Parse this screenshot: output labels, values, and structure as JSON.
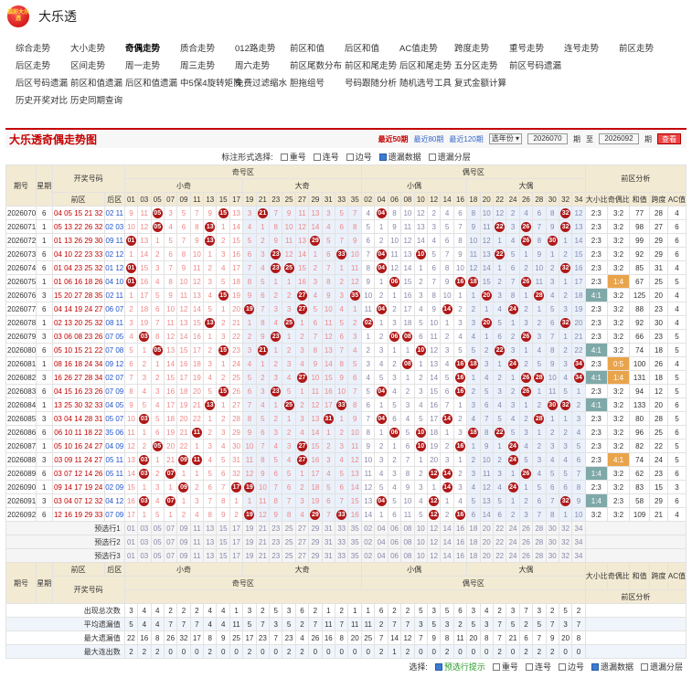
{
  "site": {
    "name": "大乐透",
    "logo_text": "福彩大乐透"
  },
  "nav": [
    [
      "综合走势",
      "大小走势",
      "奇偶走势",
      "质合走势",
      "012路走势",
      "前区和值",
      "后区和值",
      "AC值走势",
      "跨度走势",
      "重号走势",
      "连号走势",
      "前区走势"
    ],
    [
      "后区走势",
      "区间走势",
      "周一走势",
      "周三走势",
      "周六走势",
      "前区尾数分布",
      "前区和尾走势",
      "后区和尾走势",
      "五分区走势",
      "前区号码遗漏"
    ],
    [
      "后区号码遗漏",
      "前区和值遗漏",
      "后区和值遗漏",
      "中5保4旋转矩阵",
      "免费过滤缩水",
      "胆拖组号",
      "号码跟随分析",
      "随机选号工具",
      "复式金额计算"
    ],
    [
      "历史开奖对比",
      "历史同期查询"
    ]
  ],
  "nav_active": "奇偶走势",
  "chart": {
    "title": "大乐透奇偶走势图",
    "period_50": "最近50期",
    "period_80": "最近80期",
    "period_120": "最近120期",
    "select_year": "选年份",
    "from_issue": "2026070",
    "label_qi": "期",
    "label_to": "至",
    "to_issue": "2026092",
    "query": "查看"
  },
  "options": {
    "label": "标注形式选择:",
    "items": [
      {
        "label": "重号",
        "on": false
      },
      {
        "label": "连号",
        "on": false
      },
      {
        "label": "边号",
        "on": false
      },
      {
        "label": "遗漏数据",
        "on": true
      },
      {
        "label": "遗漏分层",
        "on": false
      }
    ]
  },
  "headers": {
    "issue": "期号",
    "week": "星期",
    "draw": "开奖号码",
    "front": "前区",
    "back": "后区",
    "odd_zone": "奇号区",
    "even_zone": "偶号区",
    "small_odd": "小奇",
    "big_odd": "大奇",
    "small_even": "小偶",
    "big_even": "大偶",
    "analysis": "前区分析",
    "cols_analysis": [
      "大小比",
      "奇偶比",
      "和值",
      "跨度",
      "AC值"
    ],
    "odd_nums": [
      "01",
      "03",
      "05",
      "07",
      "09",
      "11",
      "13",
      "15",
      "17",
      "19",
      "21",
      "23",
      "25",
      "27",
      "29",
      "31",
      "33",
      "35"
    ],
    "even_nums": [
      "02",
      "04",
      "06",
      "08",
      "10",
      "12",
      "14",
      "16",
      "18",
      "20",
      "22",
      "24",
      "26",
      "28",
      "30",
      "32",
      "34"
    ]
  },
  "rows": [
    {
      "issue": "2026070",
      "week": "6",
      "front": "04 05 15 21 32",
      "back": "02 11",
      "balls": [
        "05",
        "15",
        "21",
        "32",
        "04"
      ],
      "an": [
        "2:3",
        "3:2",
        "77",
        "28",
        "4"
      ]
    },
    {
      "issue": "2026071",
      "week": "1",
      "front": "05 13 22 26 32",
      "back": "02 03",
      "balls": [
        "05",
        "13",
        "22",
        "26",
        "32"
      ],
      "an": [
        "2:3",
        "3:2",
        "98",
        "27",
        "6"
      ]
    },
    {
      "issue": "2026072",
      "week": "1",
      "front": "01 13 26 29 30",
      "back": "09 11",
      "balls": [
        "01",
        "13",
        "26",
        "29",
        "30"
      ],
      "an": [
        "2:3",
        "3:2",
        "99",
        "29",
        "6"
      ]
    },
    {
      "issue": "2026073",
      "week": "6",
      "front": "04 10 22 23 33",
      "back": "02 12",
      "balls": [
        "04",
        "10",
        "22",
        "23",
        "33"
      ],
      "an": [
        "2:3",
        "3:2",
        "92",
        "29",
        "6"
      ]
    },
    {
      "issue": "2026074",
      "week": "6",
      "front": "01 04 23 25 32",
      "back": "01 12",
      "balls": [
        "01",
        "04",
        "23",
        "25",
        "32"
      ],
      "an": [
        "2:3",
        "3:2",
        "85",
        "31",
        "4"
      ]
    },
    {
      "issue": "2026075",
      "week": "1",
      "front": "01 06 16 18 26",
      "back": "04 10",
      "balls": [
        "01",
        "06",
        "16",
        "18",
        "26"
      ],
      "an": [
        "2:3",
        "1:4",
        "67",
        "25",
        "5"
      ]
    },
    {
      "issue": "2026076",
      "week": "3",
      "front": "15 20 27 28 35",
      "back": "02 11",
      "balls": [
        "15",
        "20",
        "27",
        "28",
        "35"
      ],
      "an": [
        "4:1",
        "3:2",
        "125",
        "20",
        "4"
      ]
    },
    {
      "issue": "2026077",
      "week": "6",
      "front": "04 14 19 24 27",
      "back": "06 07",
      "balls": [
        "04",
        "14",
        "19",
        "24",
        "27"
      ],
      "an": [
        "2:3",
        "3:2",
        "88",
        "23",
        "4"
      ]
    },
    {
      "issue": "2026078",
      "week": "1",
      "front": "02 13 20 25 32",
      "back": "08 11",
      "balls": [
        "02",
        "13",
        "20",
        "25",
        "32"
      ],
      "an": [
        "2:3",
        "3:2",
        "92",
        "30",
        "4"
      ]
    },
    {
      "issue": "2026079",
      "week": "3",
      "front": "03 06 08 23 26",
      "back": "07 05",
      "balls": [
        "03",
        "06",
        "08",
        "23",
        "26"
      ],
      "an": [
        "2:3",
        "3:2",
        "66",
        "23",
        "5"
      ]
    },
    {
      "issue": "2026080",
      "week": "6",
      "front": "05 10 15 21 22",
      "back": "07 08",
      "balls": [
        "05",
        "10",
        "15",
        "21",
        "22"
      ],
      "an": [
        "4:1",
        "3:2",
        "74",
        "18",
        "5"
      ]
    },
    {
      "issue": "2026081",
      "week": "1",
      "front": "08 16 18 24 34",
      "back": "09 12",
      "balls": [
        "08",
        "16",
        "18",
        "24",
        "34"
      ],
      "an": [
        "2:3",
        "0:5",
        "100",
        "26",
        "4"
      ]
    },
    {
      "issue": "2026082",
      "week": "3",
      "front": "16 26 27 28 34",
      "back": "02 07",
      "balls": [
        "16",
        "26",
        "27",
        "28",
        "34"
      ],
      "an": [
        "4:1",
        "1:4",
        "131",
        "18",
        "5"
      ]
    },
    {
      "issue": "2026083",
      "week": "6",
      "front": "04 15 16 23 26",
      "back": "07 09",
      "balls": [
        "04",
        "15",
        "16",
        "23",
        "26"
      ],
      "an": [
        "2:3",
        "3:2",
        "94",
        "12",
        "5"
      ]
    },
    {
      "issue": "2026084",
      "week": "1",
      "front": "13 25 30 32 33",
      "back": "04 05",
      "balls": [
        "13",
        "25",
        "30",
        "32",
        "33"
      ],
      "an": [
        "4:1",
        "3:2",
        "133",
        "20",
        "6"
      ]
    },
    {
      "issue": "2026085",
      "week": "3",
      "front": "03 04 14 28 31",
      "back": "05 07",
      "balls": [
        "03",
        "04",
        "14",
        "28",
        "31"
      ],
      "an": [
        "2:3",
        "3:2",
        "80",
        "28",
        "5"
      ]
    },
    {
      "issue": "2026086",
      "week": "6",
      "front": "06 10 11 18 22",
      "back": "35 06",
      "balls": [
        "06",
        "10",
        "11",
        "18",
        "22"
      ],
      "an": [
        "2:3",
        "3:2",
        "96",
        "25",
        "6"
      ]
    },
    {
      "issue": "2026087",
      "week": "1",
      "front": "05 10 16 24 27",
      "back": "04 09",
      "balls": [
        "05",
        "10",
        "16",
        "24",
        "27"
      ],
      "an": [
        "2:3",
        "3:2",
        "82",
        "22",
        "5"
      ]
    },
    {
      "issue": "2026088",
      "week": "3",
      "front": "03 09 11 24 27",
      "back": "05 11",
      "balls": [
        "03",
        "09",
        "11",
        "24",
        "27"
      ],
      "an": [
        "2:3",
        "4:1",
        "74",
        "24",
        "5"
      ]
    },
    {
      "issue": "2026089",
      "week": "6",
      "front": "03 07 12 14 26",
      "back": "05 11",
      "balls": [
        "03",
        "07",
        "12",
        "14",
        "26"
      ],
      "an": [
        "1:4",
        "3:2",
        "62",
        "23",
        "6"
      ]
    },
    {
      "issue": "2026090",
      "week": "1",
      "front": "09 14 17 19 24",
      "back": "02 09",
      "balls": [
        "09",
        "14",
        "17",
        "19",
        "24"
      ],
      "an": [
        "2:3",
        "3:2",
        "83",
        "15",
        "3"
      ]
    },
    {
      "issue": "2026091",
      "week": "3",
      "front": "03 04 07 12 32",
      "back": "04 12",
      "balls": [
        "03",
        "04",
        "07",
        "12",
        "32"
      ],
      "an": [
        "1:4",
        "2:3",
        "58",
        "29",
        "6"
      ]
    },
    {
      "issue": "2026092",
      "week": "6",
      "front": "12 16 19 29 33",
      "back": "07 09",
      "balls": [
        "12",
        "16",
        "19",
        "29",
        "33"
      ],
      "an": [
        "3:2",
        "3:2",
        "109",
        "21",
        "4"
      ]
    }
  ],
  "preselect": [
    "预选行1",
    "预选行2",
    "预选行3"
  ],
  "stats": [
    {
      "label": "出现总次数",
      "vals": [
        "3",
        "4",
        "4",
        "2",
        "2",
        "2",
        "4",
        "4",
        "1",
        "3",
        "2",
        "5",
        "3",
        "6",
        "2",
        "1",
        "2",
        "1",
        "1",
        "6",
        "2",
        "2",
        "5",
        "3",
        "5",
        "6",
        "3",
        "4",
        "2",
        "3",
        "7",
        "3",
        "2",
        "5",
        "2"
      ]
    },
    {
      "label": "平均遗漏值",
      "vals": [
        "5",
        "4",
        "4",
        "7",
        "7",
        "7",
        "4",
        "4",
        "11",
        "5",
        "7",
        "3",
        "5",
        "2",
        "7",
        "11",
        "7",
        "11",
        "11",
        "2",
        "7",
        "7",
        "3",
        "5",
        "3",
        "2",
        "5",
        "3",
        "7",
        "5",
        "2",
        "5",
        "7",
        "3",
        "7"
      ]
    },
    {
      "label": "最大遗漏值",
      "vals": [
        "22",
        "16",
        "8",
        "26",
        "32",
        "17",
        "8",
        "9",
        "25",
        "17",
        "23",
        "7",
        "23",
        "4",
        "26",
        "16",
        "8",
        "20",
        "25",
        "7",
        "14",
        "12",
        "7",
        "9",
        "8",
        "11",
        "20",
        "8",
        "7",
        "21",
        "6",
        "7",
        "9",
        "20",
        "8"
      ]
    },
    {
      "label": "最大连出数",
      "vals": [
        "2",
        "2",
        "2",
        "0",
        "0",
        "0",
        "2",
        "0",
        "0",
        "2",
        "0",
        "0",
        "2",
        "2",
        "0",
        "0",
        "0",
        "0",
        "0",
        "2",
        "1",
        "2",
        "0",
        "0",
        "2",
        "0",
        "0",
        "0",
        "2",
        "0",
        "2",
        "2",
        "2",
        "0",
        "0"
      ]
    }
  ],
  "bottom": {
    "label": "选择:",
    "items": [
      {
        "label": "预选行提示",
        "on": true
      },
      {
        "label": "重号",
        "on": false
      },
      {
        "label": "连号",
        "on": false
      },
      {
        "label": "边号",
        "on": false
      },
      {
        "label": "遗漏数据",
        "on": true
      },
      {
        "label": "遗漏分层",
        "on": false
      }
    ]
  },
  "colors": {
    "accent": "#c40000",
    "ball": "#b01818",
    "header_bg": "#f3ead3",
    "orange": "#e9a44b",
    "teal": "#7fa9a8"
  }
}
